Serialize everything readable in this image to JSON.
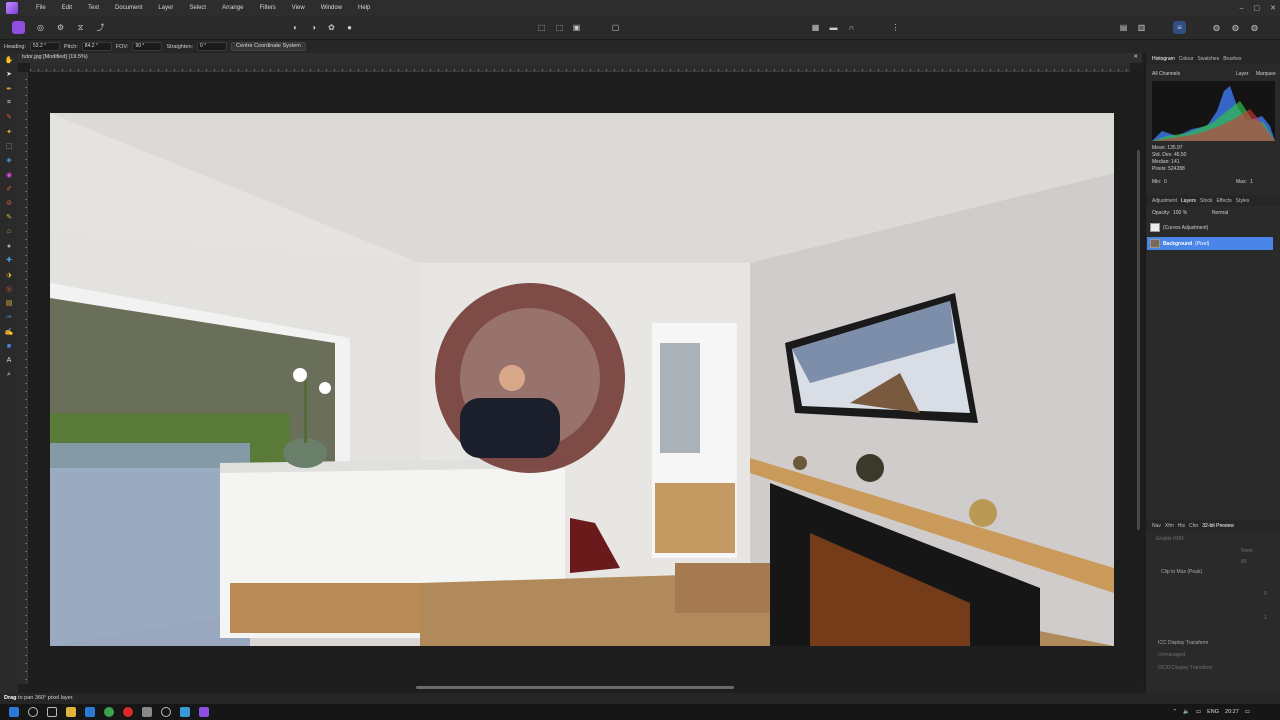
{
  "window": {
    "menu": [
      "File",
      "Edit",
      "Text",
      "Document",
      "Layer",
      "Select",
      "Arrange",
      "Filters",
      "View",
      "Window",
      "Help"
    ],
    "controls": [
      "–",
      "▢",
      "✕"
    ]
  },
  "context_toolbar": {
    "heading_label": "Heading:",
    "heading_value": "53.2 °",
    "pitch_label": "Pitch:",
    "pitch_value": "84.2 °",
    "fov_label": "FOV:",
    "fov_value": "90 °",
    "straighten_label": "Straighten:",
    "straighten_value": "0 °",
    "centre_button": "Centre Coordinate System"
  },
  "document": {
    "tab_title": "tutor.jpg [Modified] (19.5%)"
  },
  "right_panel": {
    "top_tabs": [
      "Histogram",
      "Colour",
      "Swatches",
      "Brushes"
    ],
    "channel_select": "All Channels",
    "layer_option": "Layer",
    "marquee_option": "Marquee",
    "stats": {
      "mean": "Mean: 135.97",
      "std_dev": "Std. Dev: 46.50",
      "median": "Median: 141",
      "pixels": "Pixels: 524288"
    },
    "min_label": "Min:",
    "min_value": "0",
    "max_label": "Max:",
    "max_value": "1",
    "layer_tabs": [
      "Adjustment",
      "Layers",
      "Stock",
      "Effects",
      "Styles"
    ],
    "opacity_label": "Opacity:",
    "opacity_value": "100 %",
    "blend_mode": "Normal",
    "layers": [
      {
        "name": "(Curves Adjustment)",
        "selected": false
      },
      {
        "name": "Background",
        "type": "(Pixel)",
        "selected": true
      }
    ],
    "bottom_tabs": [
      "Nav",
      "Xfm",
      "His",
      "Chn",
      "32-bit Preview"
    ],
    "preview_options": {
      "enable_hdr": "Enable HDR",
      "clip_to_max": "Clip to Max (Peak)",
      "icc_display": "ICC Display Transform",
      "unmanaged": "Unmanaged",
      "ocio_display": "OCIO Display Transform",
      "none_select": "None",
      "value_80": "80",
      "value_0": "0",
      "value_1": "1"
    }
  },
  "status": {
    "bold": "Drag",
    "text": " to pan 360° pixel layer."
  },
  "taskbar": {
    "lang": "ENG",
    "time": "20:27"
  },
  "colors": {
    "accent": "#4a86e8",
    "app_logo": "#9b59ff",
    "bg": "#1e1e1e"
  }
}
